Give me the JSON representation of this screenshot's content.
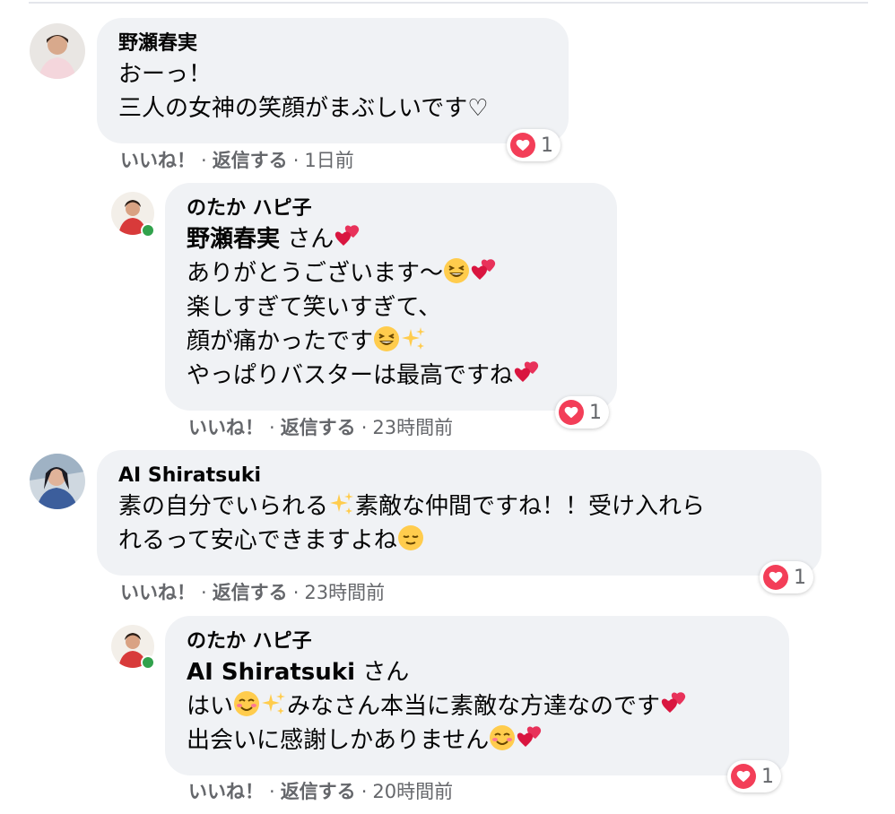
{
  "comments": [
    {
      "author": "野瀬春実",
      "lines": [
        "おーっ！",
        "三人の女神の笑顔がまぶしいです♡"
      ],
      "reaction_count": "1",
      "like": "いいね！",
      "reply": "返信する",
      "time": "1日前"
    },
    {
      "author": "のたか ハピ子",
      "mention": "野瀬春実",
      "mention_suffix": " さん",
      "lines": [
        "ありがとうございます〜",
        "楽しすぎて笑いすぎて、",
        "顔が痛かったです",
        "やっぱりバスターは最高ですね"
      ],
      "reaction_count": "1",
      "like": "いいね！",
      "reply": "返信する",
      "time": "23時間前"
    },
    {
      "author": "AI Shiratsuki",
      "lines": [
        "素の自分でいられる",
        "素敵な仲間ですね！！受け入れら",
        "れるって安心できますよね"
      ],
      "reaction_count": "1",
      "like": "いいね！",
      "reply": "返信する",
      "time": "23時間前"
    },
    {
      "author": "のたか ハピ子",
      "mention": "AI Shiratsuki",
      "mention_suffix": " さん",
      "lines": [
        "はい",
        "みなさん本当に素敵な方達なのです",
        "出会いに感謝しかありません"
      ],
      "reaction_count": "1",
      "like": "いいね！",
      "reply": "返信する",
      "time": "20時間前"
    }
  ],
  "separator": "·",
  "colors": {
    "bubble": "#f0f2f5",
    "meta": "#65676b",
    "heart": "#f33e58",
    "online": "#31a24c"
  },
  "icons": [
    "heart-reaction-icon",
    "grinning-squint-emoji",
    "sparkles-emoji",
    "two-hearts-emoji",
    "smiling-blush-emoji",
    "relieved-emoji"
  ]
}
